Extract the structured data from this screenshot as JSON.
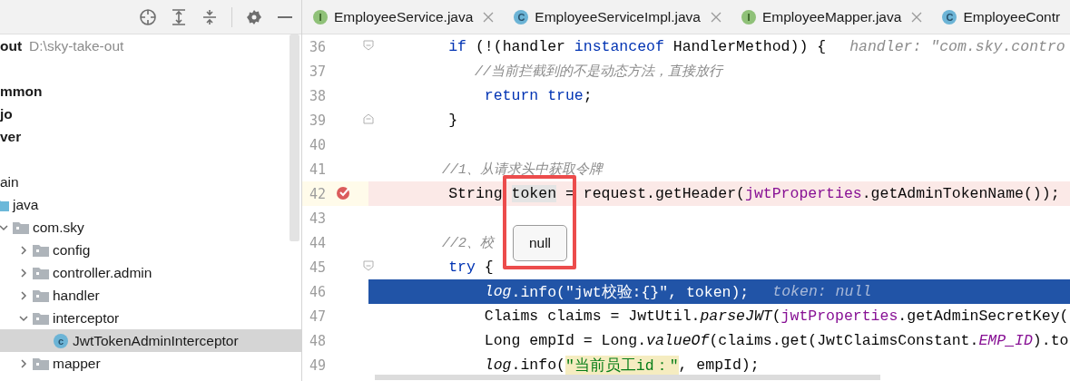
{
  "project_panel": {
    "tree": [
      {
        "label": "out",
        "kind": "project",
        "path": "D:\\sky-take-out",
        "children": [
          {
            "label": "mmon",
            "kind": "module"
          },
          {
            "label": "jo",
            "kind": "module"
          },
          {
            "label": "ver",
            "kind": "module",
            "children": [
              {
                "label": "ain",
                "children": [
                  {
                    "label": "java",
                    "kind": "source_root",
                    "children": [
                      {
                        "label": "com.sky",
                        "kind": "package",
                        "expanded": true,
                        "children": [
                          {
                            "label": "config",
                            "kind": "package",
                            "expanded": false
                          },
                          {
                            "label": "controller.admin",
                            "kind": "package",
                            "expanded": false
                          },
                          {
                            "label": "handler",
                            "kind": "package",
                            "expanded": false
                          },
                          {
                            "label": "interceptor",
                            "kind": "package",
                            "expanded": true,
                            "children": [
                              {
                                "label": "JwtTokenAdminInterceptor",
                                "kind": "class",
                                "icon_letter": "c",
                                "selected": true
                              }
                            ]
                          },
                          {
                            "label": "mapper",
                            "kind": "package",
                            "expanded": false
                          }
                        ]
                      }
                    ]
                  }
                ]
              }
            ]
          }
        ]
      }
    ]
  },
  "tabs": [
    {
      "label": "EmployeeService.java",
      "kind": "interface",
      "badge": "I",
      "close_button": true
    },
    {
      "label": "EmployeeServiceImpl.java",
      "kind": "class",
      "badge": "C",
      "close_button": true
    },
    {
      "label": "EmployeeMapper.java",
      "kind": "interface",
      "badge": "I",
      "close_button": true
    },
    {
      "label": "EmployeeContr",
      "kind": "class",
      "badge": "C"
    }
  ],
  "code_lines": [
    {
      "number": "36",
      "fold_start": true,
      "segments": [
        {
          "text": "        if",
          "kind": "keyword"
        },
        {
          "text": " (!(handler ",
          "kind": "plain"
        },
        {
          "text": "instanceof",
          "kind": "keyword"
        },
        {
          "text": " HandlerMethod)) {",
          "kind": "plain"
        },
        {
          "text": "handler: \"com.sky.contro",
          "kind": "hint"
        }
      ]
    },
    {
      "number": "37",
      "segments": [
        {
          "text": "            //当前拦截到的不是动态方法，直接放行",
          "kind": "comment"
        }
      ]
    },
    {
      "number": "38",
      "segments": [
        {
          "text": "            return",
          "kind": "keyword"
        },
        {
          "text": " true",
          "kind": "keyword"
        },
        {
          "text": ";",
          "kind": "plain"
        }
      ]
    },
    {
      "number": "39",
      "fold_end": true,
      "segments": [
        {
          "text": "        }",
          "kind": "plain"
        }
      ]
    },
    {
      "number": "40"
    },
    {
      "number": "41",
      "segments": [
        {
          "text": "        //1、从请求头中获取令牌",
          "kind": "comment"
        }
      ]
    },
    {
      "number": "42",
      "breakpoint": true,
      "segments": [
        {
          "text": "        String ",
          "kind": "plain"
        },
        {
          "text": "token",
          "kind": "variable"
        },
        {
          "text": " = request.getHeader(",
          "kind": "plain"
        },
        {
          "text": "jwtProperties",
          "kind": "field"
        },
        {
          "text": ".getAdminTokenName());",
          "kind": "plain"
        }
      ]
    },
    {
      "number": "43"
    },
    {
      "number": "44",
      "segments": [
        {
          "text": "        //2、校",
          "kind": "comment"
        }
      ]
    },
    {
      "number": "45",
      "fold_start": true,
      "segments": [
        {
          "text": "        try",
          "kind": "keyword"
        },
        {
          "text": " {",
          "kind": "plain"
        }
      ]
    },
    {
      "number": "46",
      "current": true,
      "segments": [
        {
          "text": "            log",
          "kind": "static"
        },
        {
          "text": ".info(\"jwt校验:{}\", token);",
          "kind": "plain"
        },
        {
          "text": "token: null",
          "kind": "hint"
        }
      ]
    },
    {
      "number": "47",
      "segments": [
        {
          "text": "            Claims claims = JwtUtil.",
          "kind": "plain"
        },
        {
          "text": "parseJWT",
          "kind": "static"
        },
        {
          "text": "(",
          "kind": "plain"
        },
        {
          "text": "jwtProperties",
          "kind": "field"
        },
        {
          "text": ".getAdminSecretKey(",
          "kind": "plain"
        }
      ]
    },
    {
      "number": "48",
      "segments": [
        {
          "text": "            Long empId = Long.",
          "kind": "plain"
        },
        {
          "text": "valueOf",
          "kind": "static"
        },
        {
          "text": "(claims.get(JwtClaimsConstant.",
          "kind": "plain"
        },
        {
          "text": "EMP_ID",
          "kind": "constant"
        },
        {
          "text": ").to",
          "kind": "plain"
        }
      ]
    },
    {
      "number": "49",
      "segments": [
        {
          "text": "            log",
          "kind": "static"
        },
        {
          "text": ".info(",
          "kind": "plain"
        },
        {
          "text": "\"当前员工id：\"",
          "kind": "marked_string"
        },
        {
          "text": ", empId);",
          "kind": "plain"
        }
      ]
    }
  ],
  "value_tooltip": {
    "text": "null"
  }
}
